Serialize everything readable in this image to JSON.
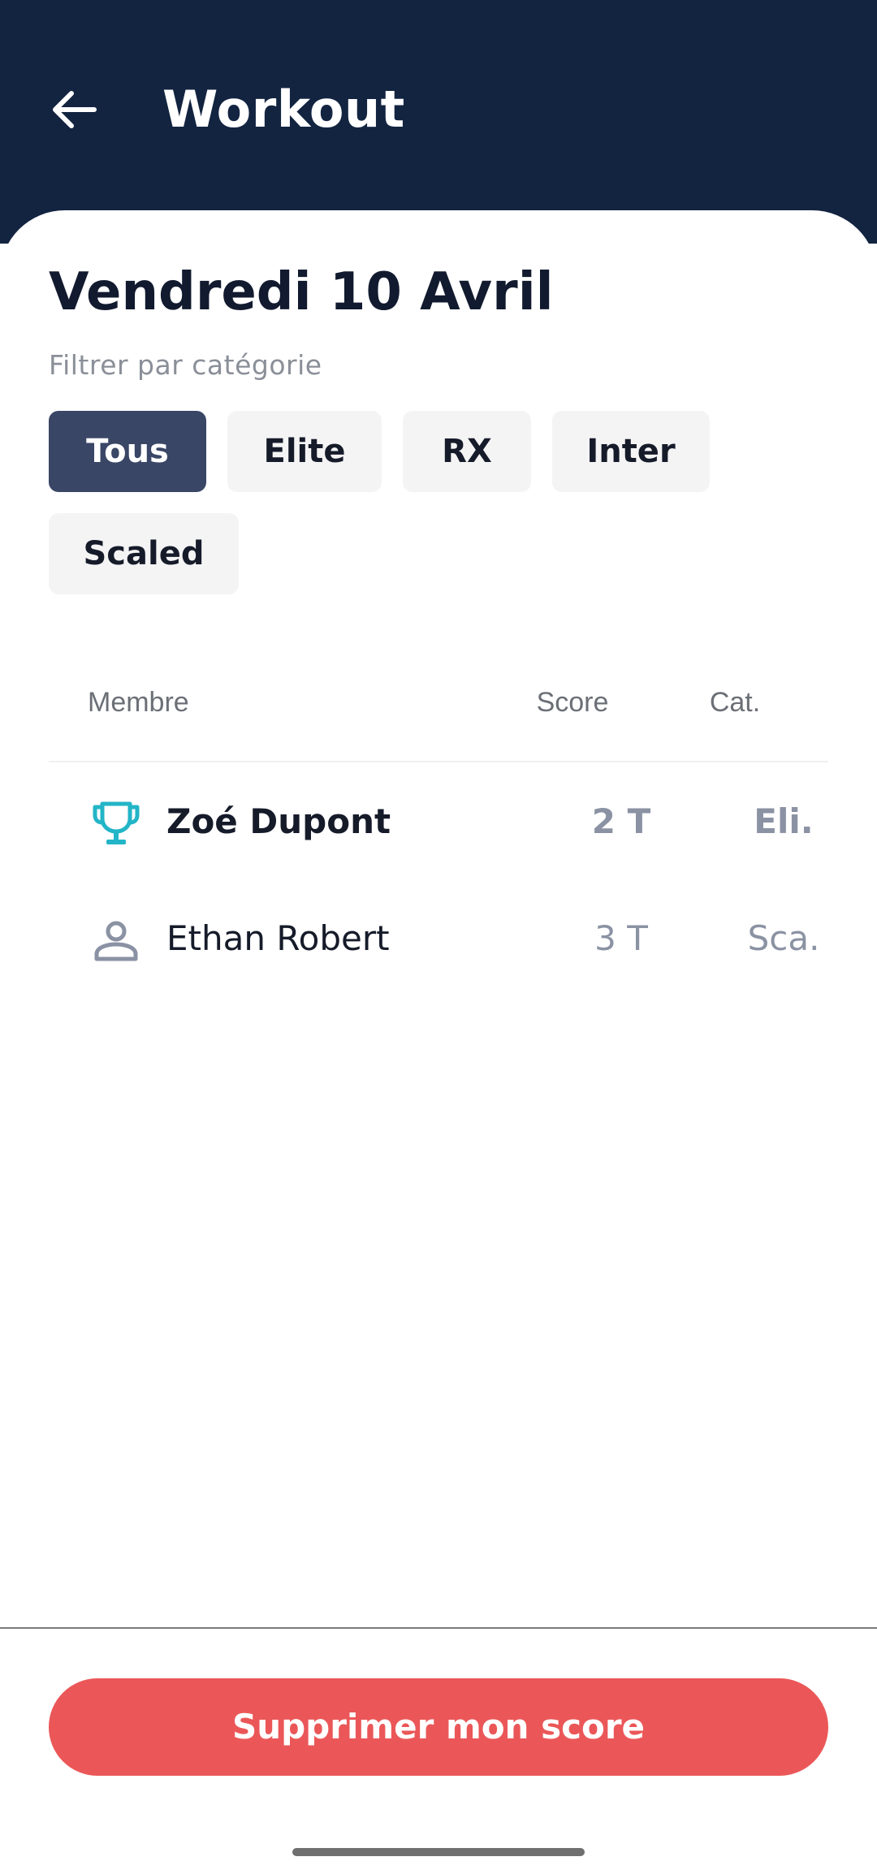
{
  "header": {
    "title": "Workout",
    "back_icon": "arrow-left-icon",
    "background": "#132441"
  },
  "date_title": "Vendredi 10 Avril",
  "filter": {
    "label": "Filtrer par catégorie",
    "chips": [
      "Tous",
      "Elite",
      "RX",
      "Inter",
      "Scaled"
    ],
    "selected": "Tous"
  },
  "table": {
    "headers": {
      "member": "Membre",
      "score": "Score",
      "category": "Cat."
    },
    "rows": [
      {
        "icon": "trophy-icon",
        "name": "Zoé Dupont",
        "score": "2 T",
        "category": "Eli.",
        "highlight": true
      },
      {
        "icon": "person-icon",
        "name": "Ethan Robert",
        "score": "3 T",
        "category": "Sca.",
        "highlight": false
      }
    ]
  },
  "actions": {
    "delete_label": "Supprimer mon score"
  },
  "colors": {
    "accent_chip": "#3a4666",
    "trophy": "#22b5c7",
    "danger": "#eb5758"
  }
}
